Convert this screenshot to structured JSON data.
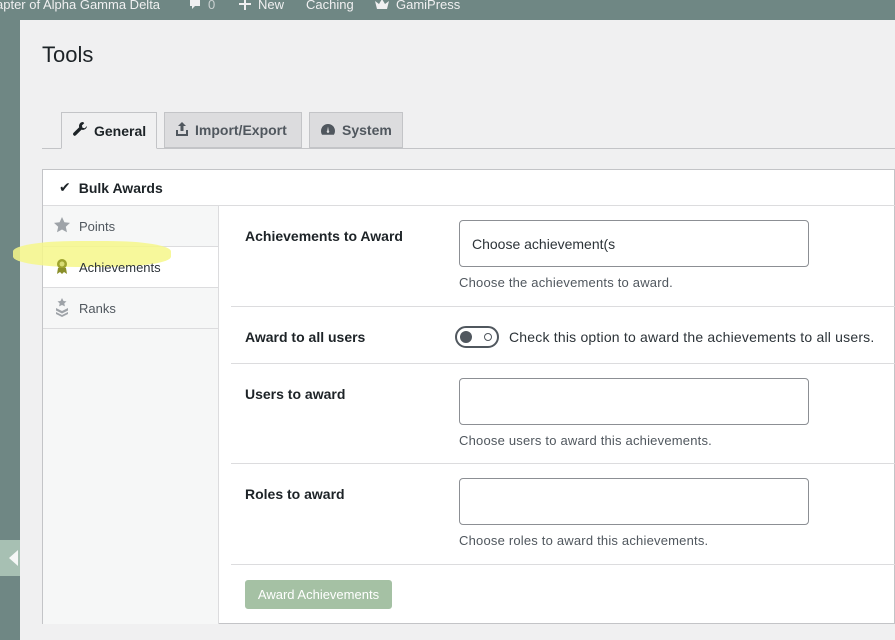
{
  "adminbar": {
    "site_name": "apter of Alpha Gamma Delta",
    "comments_count": "0",
    "new_label": "New",
    "caching_label": "Caching",
    "gamipress_label": "GamiPress"
  },
  "page": {
    "title": "Tools"
  },
  "tabs": [
    {
      "label": "General",
      "icon": "wrench-icon",
      "active": true
    },
    {
      "label": "Import/Export",
      "icon": "upload-icon",
      "active": false
    },
    {
      "label": "System",
      "icon": "dashboard-icon",
      "active": false
    }
  ],
  "panel": {
    "title": "Bulk Awards",
    "nav": [
      {
        "label": "Points",
        "icon": "star-icon",
        "active": false
      },
      {
        "label": "Achievements",
        "icon": "award-icon",
        "active": true
      },
      {
        "label": "Ranks",
        "icon": "rank-icon",
        "active": false
      }
    ],
    "form": {
      "achievements": {
        "label": "Achievements to Award",
        "placeholder": "Choose achievement(s",
        "description": "Choose the achievements to award."
      },
      "award_all": {
        "label": "Award to all users",
        "toggle_on": false,
        "description": "Check this option to award the achievements to all users."
      },
      "users": {
        "label": "Users to award",
        "value": "",
        "description": "Choose users to award this achievements."
      },
      "roles": {
        "label": "Roles to award",
        "value": "",
        "description": "Choose roles to award this achievements."
      },
      "submit_label": "Award Achievements"
    }
  },
  "colors": {
    "admin_bg": "#6f8784",
    "button_bg": "#a5c1a4",
    "highlight": "#f6f78a"
  }
}
